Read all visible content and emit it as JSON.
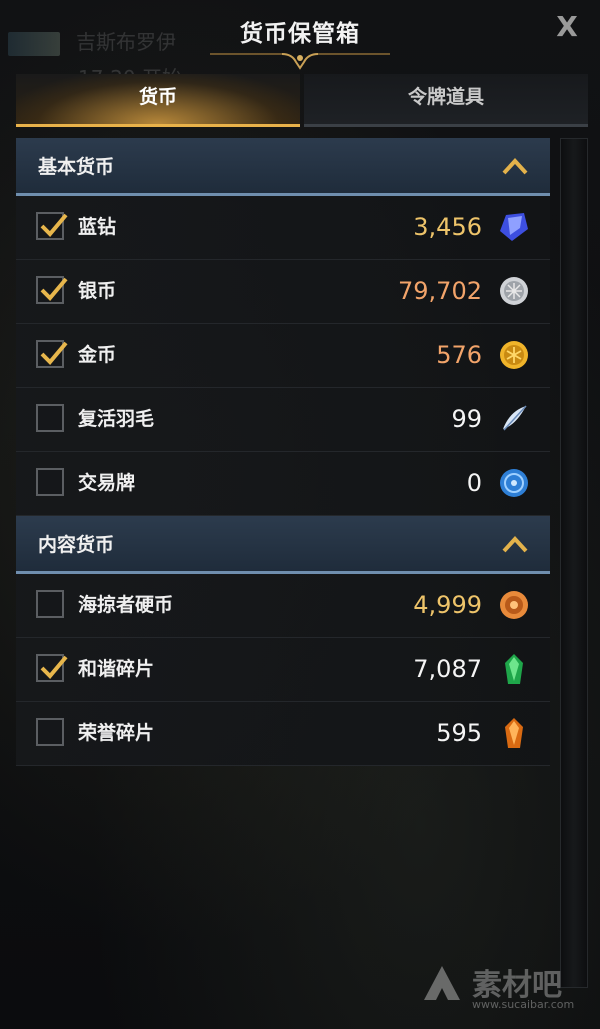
{
  "window": {
    "title": "货币保管箱",
    "close_label": "X",
    "background_name": "吉斯布罗伊",
    "background_time": "17:20 开始"
  },
  "tabs": [
    {
      "label": "货币",
      "active": true
    },
    {
      "label": "令牌道具",
      "active": false
    }
  ],
  "sections": [
    {
      "title": "基本货币",
      "items": [
        {
          "label": "蓝钻",
          "value": "3,456",
          "checked": true,
          "value_color": "#eec46a",
          "icon": "blue-diamond-icon"
        },
        {
          "label": "银币",
          "value": "79,702",
          "checked": true,
          "value_color": "#f2a46a",
          "icon": "silver-coin-icon"
        },
        {
          "label": "金币",
          "value": "576",
          "checked": true,
          "value_color": "#f2a46a",
          "icon": "gold-coin-icon"
        },
        {
          "label": "复活羽毛",
          "value": "99",
          "checked": false,
          "value_color": "#f5f5f5",
          "icon": "feather-icon"
        },
        {
          "label": "交易牌",
          "value": "0",
          "checked": false,
          "value_color": "#f5f5f5",
          "icon": "trade-token-icon"
        }
      ]
    },
    {
      "title": "内容货币",
      "items": [
        {
          "label": "海掠者硬币",
          "value": "4,999",
          "checked": false,
          "value_color": "#eec46a",
          "icon": "pirate-coin-icon"
        },
        {
          "label": "和谐碎片",
          "value": "7,087",
          "checked": true,
          "value_color": "#f5f5f5",
          "icon": "green-shard-icon"
        },
        {
          "label": "荣誉碎片",
          "value": "595",
          "checked": false,
          "value_color": "#f5f5f5",
          "icon": "orange-shard-icon"
        }
      ]
    }
  ],
  "watermark": {
    "text": "素材吧",
    "sub": "www.sucaibar.com"
  },
  "colors": {
    "accent_gold": "#e9b24a",
    "section_bar": "#2c3b4d",
    "check_gold": "#e7b64c"
  }
}
